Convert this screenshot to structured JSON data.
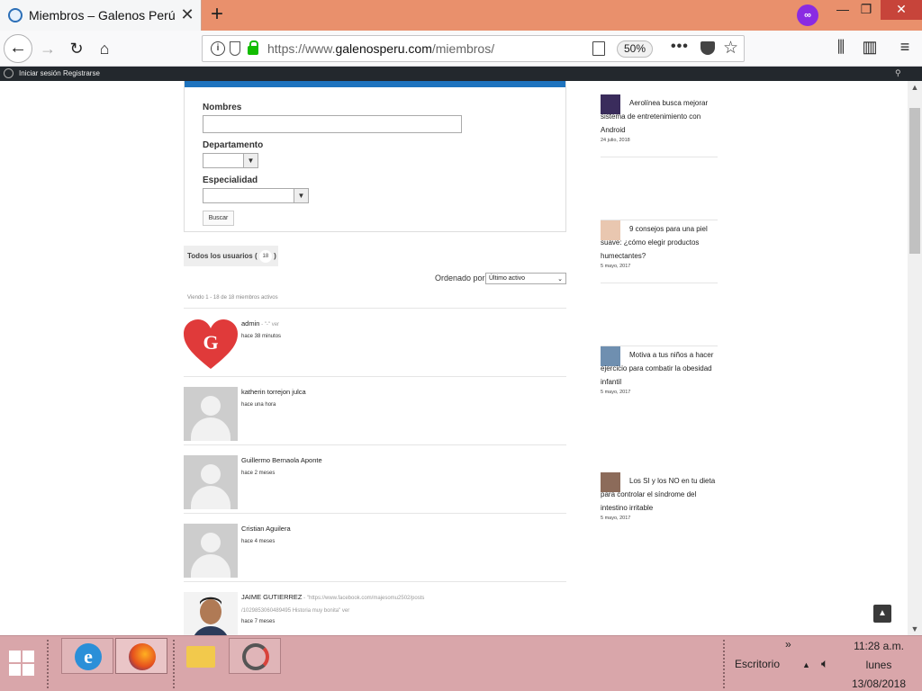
{
  "browser": {
    "tab_title": "Miembros – Galenos Perú",
    "tab_close": "✕",
    "new_tab": "+",
    "url_prefix": "https://www.",
    "url_host": "galenosperu.com",
    "url_path": "/miembros/",
    "zoom": "50%",
    "more": "•••",
    "minimize": "—",
    "restore": "❐",
    "close": "✕"
  },
  "wp_admin_bar": {
    "login": "Iniciar sesión",
    "register": "Registrarse",
    "search_icon": "magnifier-icon"
  },
  "search_form": {
    "nombres_label": "Nombres",
    "departamento_label": "Departamento",
    "especialidad_label": "Especialidad",
    "submit": "Buscar"
  },
  "directory": {
    "all_users_label": "Todos los usuarios (",
    "all_users_count": "18",
    "all_users_close": ")",
    "order_label": "Ordenado por:",
    "order_value": "Último activo",
    "viewing": "Viendo 1 - 18 de 18 miembros activos"
  },
  "members": [
    {
      "name": "admin",
      "extra": " - \"-\"   ver",
      "last_active": "hace 38 minutos"
    },
    {
      "name": "katherin torrejon julca",
      "extra": "",
      "last_active": "hace una hora"
    },
    {
      "name": "Guillermo Bernaola Aponte",
      "extra": "",
      "last_active": "hace 2 meses"
    },
    {
      "name": "Cristian Aguilera",
      "extra": "",
      "last_active": "hace 4 meses"
    },
    {
      "name": "JAIME GUTIERREZ",
      "extra": " - \"https://www.facebook.com/majesomu2502/posts",
      "extra2": "/1029853060489495  Historia muy bonita\"   ver",
      "last_active": "hace 7 meses"
    }
  ],
  "sidebar_posts": [
    {
      "title": "Aerolínea busca mejorar sistema de entretenimiento con Android",
      "date": "24 julio, 2018"
    },
    {
      "title": "9 consejos para una piel suave: ¿cómo elegir productos humectantes?",
      "date": "5 mayo, 2017"
    },
    {
      "title": "Motiva a tus niños a hacer ejercicio para combatir la obesidad infantil",
      "date": "5 mayo, 2017"
    },
    {
      "title": "Los SI y los NO en tu dieta para controlar el síndrome del intestino irritable",
      "date": "5 mayo, 2017"
    }
  ],
  "taskbar": {
    "desktop_label": "Escritorio",
    "time": "11:28 a.m.",
    "day": "lunes",
    "date": "13/08/2018",
    "overflow": "»"
  },
  "colors": {
    "titlebar": "#e9906c",
    "accent_blue": "#1e73be",
    "wpbar": "#23282d",
    "taskbar": "#d9a6aa",
    "heart_red": "#e03a3a"
  }
}
